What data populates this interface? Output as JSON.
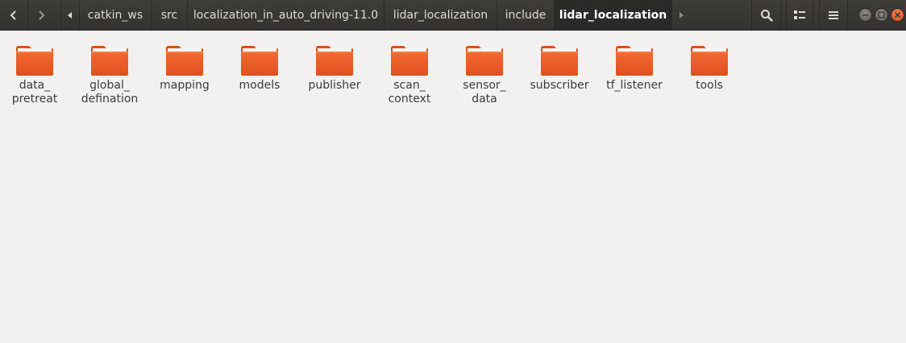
{
  "navigation": {
    "back_icon": "chevron-left-icon",
    "forward_icon": "chevron-right-icon",
    "path_scroll_left_icon": "triangle-left-icon",
    "path_scroll_right_icon": "triangle-right-icon"
  },
  "breadcrumb": {
    "items": [
      {
        "label": "catkin_ws"
      },
      {
        "label": "src"
      },
      {
        "label": "localization_in_auto_driving-11.0"
      },
      {
        "label": "lidar_localization"
      },
      {
        "label": "include"
      },
      {
        "label": "lidar_localization"
      }
    ],
    "active_index": 5
  },
  "toolbar": {
    "search_icon": "search-icon",
    "view_toggle_icon": "list-view-icon",
    "menu_icon": "hamburger-menu-icon"
  },
  "window_controls": {
    "minimize_icon": "minimize-icon",
    "maximize_icon": "maximize-icon",
    "close_icon": "close-icon"
  },
  "files": [
    {
      "label": "data_\npretreat",
      "type": "folder"
    },
    {
      "label": "global_\ndefination",
      "type": "folder"
    },
    {
      "label": "mapping",
      "type": "folder"
    },
    {
      "label": "models",
      "type": "folder"
    },
    {
      "label": "publisher",
      "type": "folder"
    },
    {
      "label": "scan_\ncontext",
      "type": "folder"
    },
    {
      "label": "sensor_\ndata",
      "type": "folder"
    },
    {
      "label": "subscriber",
      "type": "folder"
    },
    {
      "label": "tf_listener",
      "type": "folder"
    },
    {
      "label": "tools",
      "type": "folder"
    }
  ],
  "colors": {
    "header_bg": "#3c3b37",
    "folder_orange": "#e85e2a",
    "close_button": "#e95420",
    "content_bg": "#f2f1f0"
  }
}
